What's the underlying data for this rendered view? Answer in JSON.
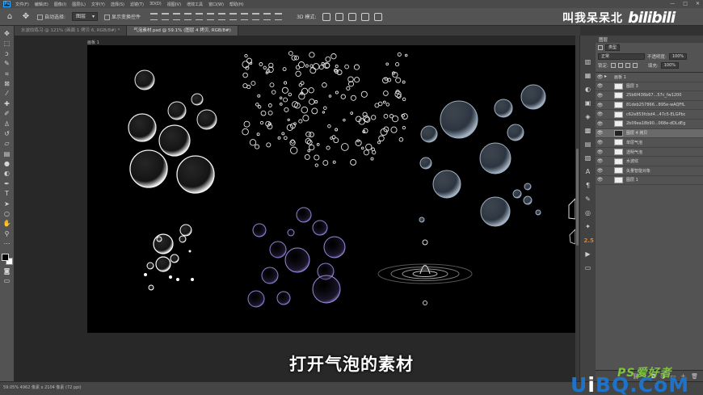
{
  "menubar": {
    "items": [
      "文件(F)",
      "编辑(E)",
      "图像(I)",
      "图层(L)",
      "文字(Y)",
      "选择(S)",
      "滤镜(T)",
      "3D(D)",
      "视图(V)",
      "增效工具",
      "窗口(W)",
      "帮助(H)"
    ],
    "window_controls": [
      "—",
      "□",
      "✕"
    ]
  },
  "options": {
    "auto_select_label": "自动选择:",
    "auto_select_value": "图层",
    "transform_label": "显示变换控件",
    "mode_label": "3D 模式:"
  },
  "brand": {
    "name": "叫我呆呆北",
    "logo": "bilibili"
  },
  "tabs": [
    {
      "label": "水波纹练习 @ 121% (画面 1 拷贝 6, RGB/8#) *",
      "active": false
    },
    {
      "label": "气泡素材.psd @ 59.1% (图层 4 拷贝, RGB/8#)",
      "active": true
    }
  ],
  "artboard": {
    "title": "画板 1"
  },
  "layers": {
    "header": "图层",
    "kind_label": "类型",
    "blend_mode": "正常",
    "opacity_label": "不透明度:",
    "opacity": "100%",
    "lock_label": "锁定:",
    "fill_label": "填充:",
    "fill": "100%",
    "items": [
      {
        "name": "画板 1",
        "type": "artboard"
      },
      {
        "name": "图层 3",
        "type": "layer"
      },
      {
        "name": "25b6f436b67...57c_fw1200",
        "type": "layer"
      },
      {
        "name": "81deb257866...895e-wAQFfL",
        "type": "layer"
      },
      {
        "name": "c62e853fcbd4...47c5-ELGPbc",
        "type": "layer"
      },
      {
        "name": "2b09ea18b90...068e-dDLdEg",
        "type": "layer"
      },
      {
        "name": "图层 4 拷贝",
        "type": "layer"
      },
      {
        "name": "单层气泡",
        "type": "layer"
      },
      {
        "name": "透明气泡",
        "type": "layer"
      },
      {
        "name": "水波纹",
        "type": "layer"
      },
      {
        "name": "矢量智能对象",
        "type": "layer"
      },
      {
        "name": "图层 1",
        "type": "layer"
      }
    ],
    "footer_icons": [
      "link-icon",
      "fx-icon",
      "mask-icon",
      "adjustment-icon",
      "group-icon",
      "new-layer-icon",
      "trash-icon"
    ]
  },
  "status": {
    "text": "59.05%   4962 像素 x 2104 像素 (72 ppi)"
  },
  "subtitle": "打开气泡的素材",
  "watermark": {
    "top": "PS爱好者",
    "main_prefix": "U",
    "main_accent": "i",
    "main_suffix": "BQ.CoM"
  },
  "colors": {
    "accent": "#31a8ff",
    "watermark_green": "#7ec242",
    "watermark_blue": "#1e73c8"
  }
}
